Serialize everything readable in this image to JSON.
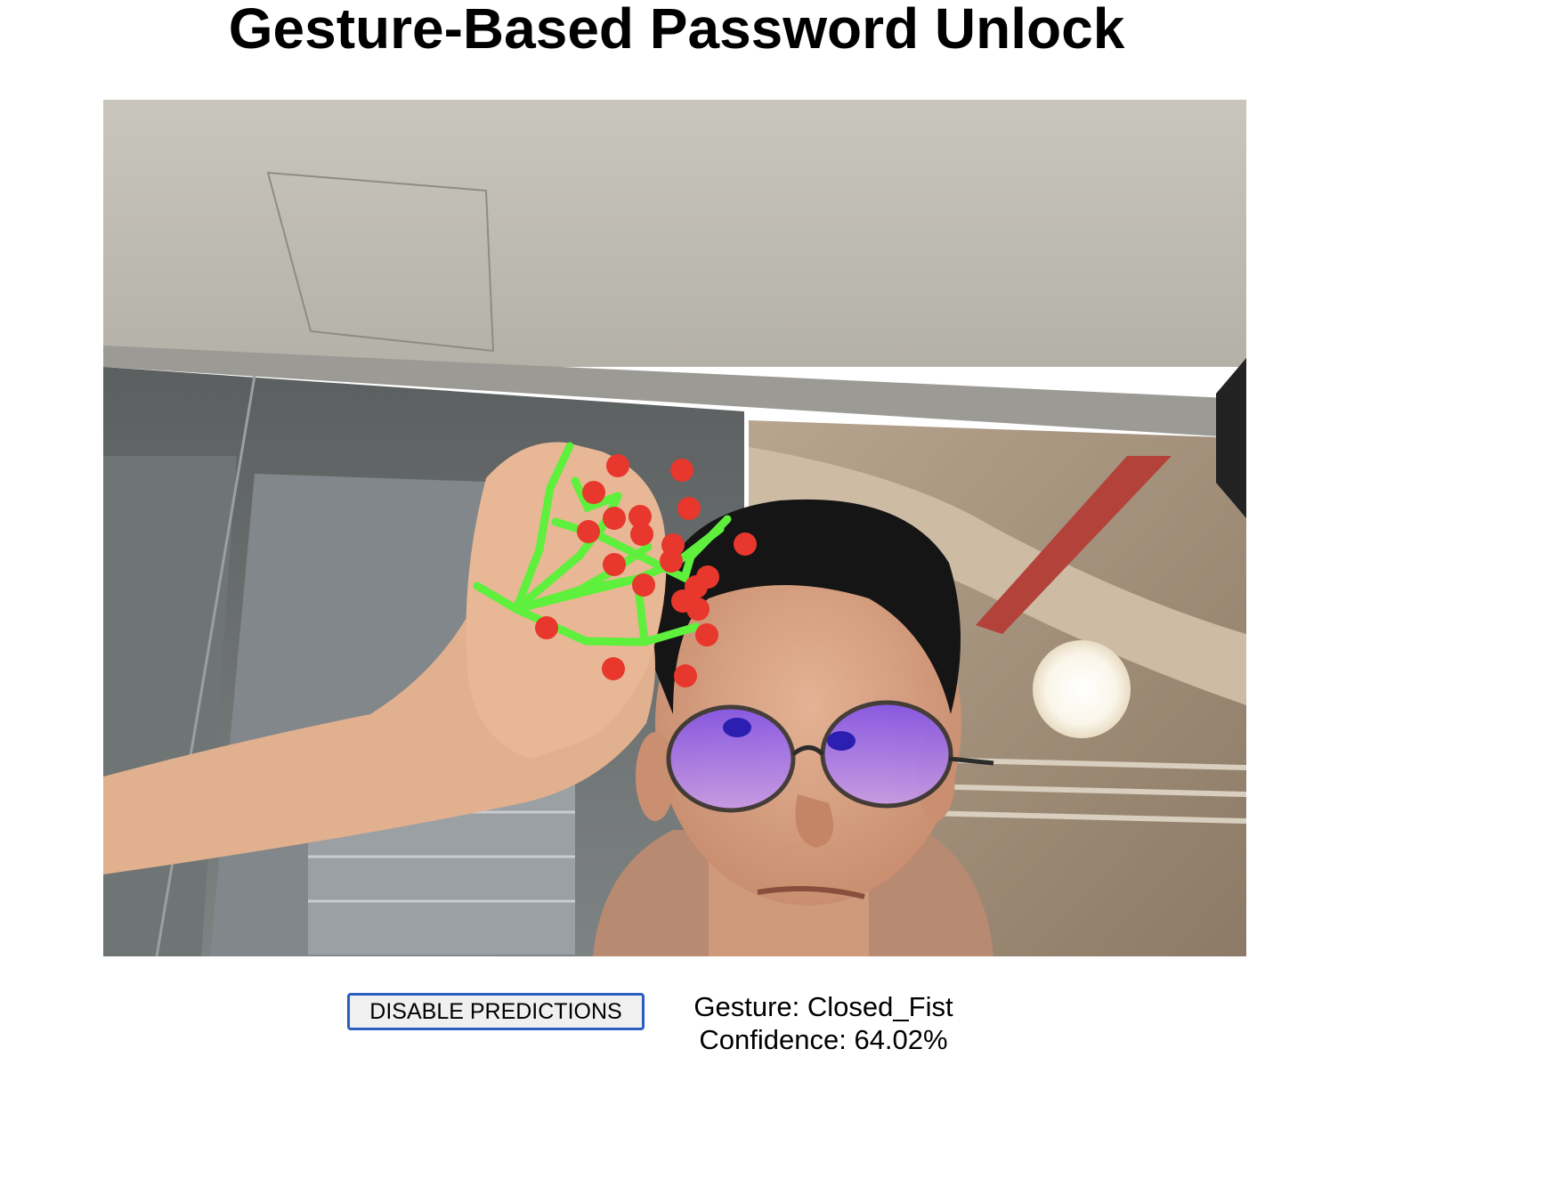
{
  "page": {
    "title": "Gesture-Based Password Unlock"
  },
  "camera": {
    "description_icon": "webcam-feed",
    "landmark_color": "#e8372c",
    "connection_color": "#5ef03c"
  },
  "controls": {
    "toggle_button_label": "DISABLE PREDICTIONS"
  },
  "result": {
    "gesture_prefix": "Gesture: ",
    "gesture_name": "Closed_Fist",
    "confidence_prefix": "Confidence: ",
    "confidence_value": "64.02%",
    "gesture_text": "Gesture: Closed_Fist",
    "confidence_text": "Confidence: 64.02%"
  }
}
